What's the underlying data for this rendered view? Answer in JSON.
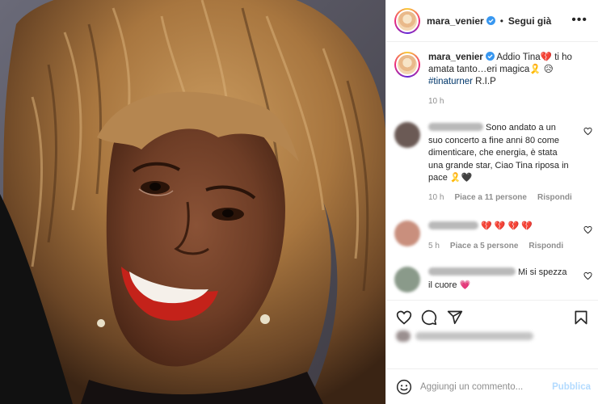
{
  "photo": {
    "description_icon": "portrait-photo"
  },
  "header": {
    "username": "mara_venier",
    "separator": "•",
    "follow_label": "Segui già",
    "more_label": "•••"
  },
  "caption": {
    "username": "mara_venier",
    "text": "Addio Tina💔  ti ho amata tanto…eri magica🎗️  😥",
    "hashtag": "#tinaturner",
    "tail": " R.I.P",
    "time": "10 h"
  },
  "comments": [
    {
      "text": "Sono andato a un suo concerto a fine anni 80 come dimenticare, che energia, è stata una grande star, Ciao Tina riposa in pace 🎗️🖤",
      "time": "10 h",
      "likes": "Piace a 11 persone",
      "reply": "Rispondi",
      "avatar_color": "#6b5a55"
    },
    {
      "text": "💔 💔 💔 💔",
      "time": "5 h",
      "likes": "Piace a 5 persone",
      "reply": "Rispondi",
      "avatar_color": "#c98f7d"
    },
    {
      "text": "Mi si spezza il cuore 💗",
      "avatar_color": "#8a9a8a"
    }
  ],
  "actions": {
    "like": "heart-icon",
    "comment": "comment-icon",
    "share": "share-icon",
    "save": "bookmark-icon"
  },
  "input": {
    "placeholder": "Aggiungi un commento...",
    "publish_label": "Pubblica"
  },
  "colors": {
    "link": "#00376b",
    "verified": "#3897f0",
    "publish_disabled": "#b3dbff",
    "heart_red": "#ed4956"
  }
}
